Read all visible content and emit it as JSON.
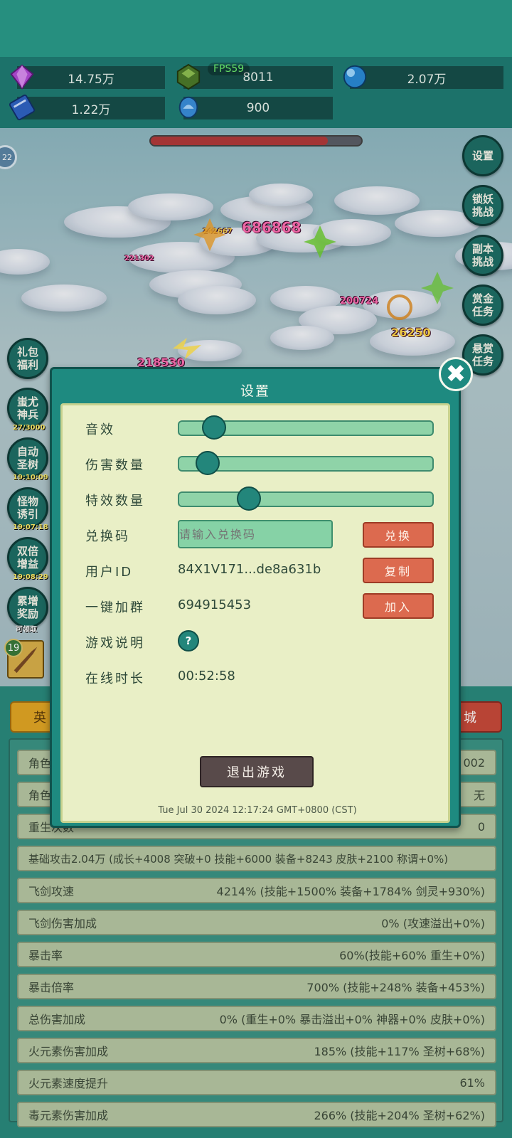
{
  "fps": "FPS59",
  "resources": [
    {
      "icon": "purple-gem-icon",
      "value": "14.75万"
    },
    {
      "icon": "green-crystal-icon",
      "value": "8011"
    },
    {
      "icon": "blue-orb-icon",
      "value": "2.07万"
    },
    {
      "icon": "blue-book-icon",
      "value": "1.22万"
    },
    {
      "icon": "blue-fish-icon",
      "value": "900"
    }
  ],
  "battle": {
    "level_badge": "22",
    "boss_hp_fraction": 0.84,
    "damage_numbers": [
      "686868",
      "242667",
      "221302",
      "200724",
      "26250",
      "218530"
    ]
  },
  "right_menu": [
    "设置",
    "锁妖\n挑战",
    "副本\n挑战",
    "赏金\n任务",
    "悬赏\n任务"
  ],
  "left_menu": [
    {
      "label": "礼包\n福利",
      "timer": ""
    },
    {
      "label": "蚩尤\n神兵",
      "timer": "27/3000"
    },
    {
      "label": "自动\n圣树",
      "timer": "19:10:09"
    },
    {
      "label": "怪物\n诱引",
      "timer": "19:07:18"
    },
    {
      "label": "双倍\n增益",
      "timer": "19:08:29"
    },
    {
      "label": "累增\n奖励",
      "timer": "可领取"
    }
  ],
  "item_badge": "19",
  "tabs": {
    "left": "英",
    "right": "城"
  },
  "stats": [
    {
      "label": "角色",
      "value": "002"
    },
    {
      "label": "角色",
      "value": "无"
    },
    {
      "label": "重生次数",
      "value": "0"
    },
    {
      "label": "基础攻击2.04万 (成长+4008 突破+0 技能+6000 装备+8243 皮肤+2100 称谓+0%)",
      "value": ""
    },
    {
      "label": "飞剑攻速",
      "value": "4214% (技能+1500% 装备+1784% 剑灵+930%)"
    },
    {
      "label": "飞剑伤害加成",
      "value": "0% (攻速溢出+0%)"
    },
    {
      "label": "暴击率",
      "value": "60%(技能+60% 重生+0%)"
    },
    {
      "label": "暴击倍率",
      "value": "700% (技能+248% 装备+453%)"
    },
    {
      "label": "总伤害加成",
      "value": "0% (重生+0% 暴击溢出+0% 神器+0% 皮肤+0%)"
    },
    {
      "label": "火元素伤害加成",
      "value": "185% (技能+117% 圣树+68%)"
    },
    {
      "label": "火元素速度提升",
      "value": "61%"
    },
    {
      "label": "毒元素伤害加成",
      "value": "266% (技能+204% 圣树+62%)"
    }
  ],
  "settings": {
    "title": "设置",
    "close_symbol": "✖",
    "sound_label": "音效",
    "sound_level": 0.1,
    "damage_count_label": "伤害数量",
    "damage_count_level": 0.07,
    "effects_count_label": "特效数量",
    "effects_count_level": 0.25,
    "redeem_label": "兑换码",
    "redeem_placeholder": "请输入兑换码",
    "redeem_button": "兑换",
    "user_id_label": "用户ID",
    "user_id_value": "84X1V171...de8a631b",
    "copy_button": "复制",
    "group_label": "一键加群",
    "group_value": "694915453",
    "join_button": "加入",
    "help_label": "游戏说明",
    "help_symbol": "?",
    "online_label": "在线时长",
    "online_value": "00:52:58",
    "exit_button": "退出游戏",
    "timestamp": "Tue Jul 30 2024 12:17:24 GMT+0800 (CST)"
  }
}
